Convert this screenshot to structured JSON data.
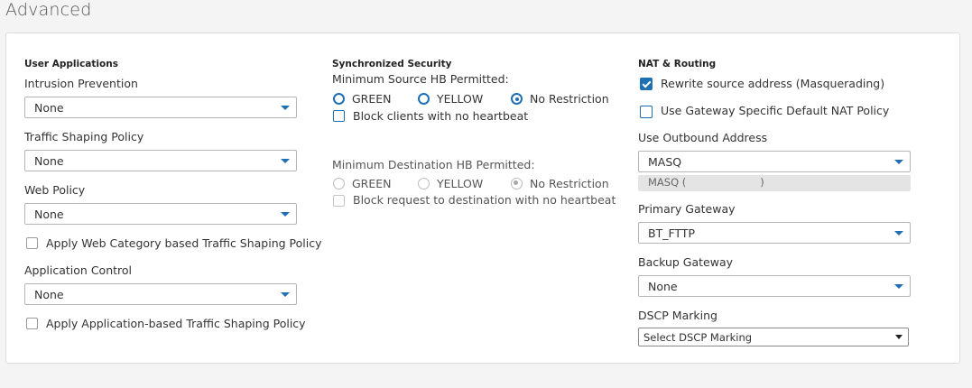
{
  "page": {
    "title": "Advanced"
  },
  "user_applications": {
    "heading": "User Applications",
    "intrusion_prevention": {
      "label": "Intrusion Prevention",
      "value": "None"
    },
    "traffic_shaping": {
      "label": "Traffic Shaping Policy",
      "value": "None"
    },
    "web_policy": {
      "label": "Web Policy",
      "value": "None"
    },
    "web_category_shaping": {
      "label": "Apply Web Category based Traffic Shaping Policy",
      "checked": false
    },
    "application_control": {
      "label": "Application Control",
      "value": "None"
    },
    "app_based_shaping": {
      "label": "Apply Application-based Traffic Shaping Policy",
      "checked": false
    }
  },
  "synchronized_security": {
    "heading": "Synchronized Security",
    "min_source": {
      "label": "Minimum Source HB Permitted:",
      "options": [
        "GREEN",
        "YELLOW",
        "No Restriction"
      ],
      "selected": "No Restriction"
    },
    "block_clients": {
      "label": "Block clients with no heartbeat",
      "checked": false
    },
    "min_destination": {
      "label": "Minimum Destination HB Permitted:",
      "options": [
        "GREEN",
        "YELLOW",
        "No Restriction"
      ],
      "selected": "No Restriction",
      "disabled": true
    },
    "block_request": {
      "label": "Block request to destination with no heartbeat",
      "checked": false,
      "disabled": true
    }
  },
  "nat_routing": {
    "heading": "NAT & Routing",
    "rewrite_source": {
      "label": "Rewrite source address (Masquerading)",
      "checked": true
    },
    "gateway_nat": {
      "label": "Use Gateway Specific Default NAT Policy",
      "checked": false
    },
    "outbound_address": {
      "label": "Use Outbound Address",
      "value": "MASQ",
      "sub_prefix": "MASQ (",
      "sub_suffix": ")"
    },
    "primary_gateway": {
      "label": "Primary Gateway",
      "value": "BT_FTTP"
    },
    "backup_gateway": {
      "label": "Backup Gateway",
      "value": "None"
    },
    "dscp_marking": {
      "label": "DSCP Marking",
      "value": "Select DSCP Marking"
    }
  },
  "colors": {
    "accent": "#1f6fb3",
    "panel_border": "#dcdcdc",
    "page_bg": "#f4f4f4"
  }
}
